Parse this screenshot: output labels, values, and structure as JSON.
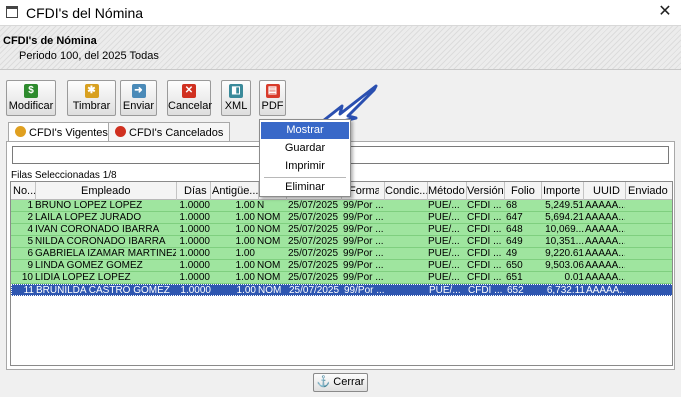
{
  "window": {
    "title": "CFDI's del Nómina",
    "close_glyph": "✕"
  },
  "header": {
    "title": "CFDI's de Nómina",
    "subtitle": "Periodo 100, del 2025 Todas"
  },
  "toolbar": [
    {
      "label": "Modificar",
      "icon": "dollar-icon",
      "color": "#2e8b2e",
      "glyph": "$"
    },
    {
      "label": "Timbrar",
      "icon": "stamp-icon",
      "color": "#d8a020",
      "glyph": "✱"
    },
    {
      "label": "Enviar",
      "icon": "send-icon",
      "color": "#4a8ab8",
      "glyph": "➜"
    },
    {
      "label": "Cancelar",
      "icon": "cancel-icon",
      "color": "#d03020",
      "glyph": "✕"
    },
    {
      "label": "XML",
      "icon": "xml-icon",
      "color": "#3a8a9a",
      "glyph": "◧"
    },
    {
      "label": "PDF",
      "icon": "pdf-icon",
      "color": "#d83a2a",
      "glyph": "▤"
    }
  ],
  "tabs": [
    {
      "label": "CFDI's Vigentes",
      "icon": "star-icon",
      "color": "#e0a020"
    },
    {
      "label": "CFDI's Cancelados",
      "icon": "cancel-circle-icon",
      "color": "#d03020"
    }
  ],
  "grid": {
    "row_count_label": "Filas Seleccionadas  1/8",
    "columns": [
      "No...",
      "Empleado",
      "Días",
      "Antigüe...",
      "",
      "",
      "Forma",
      "Condic...",
      "Método",
      "Versión",
      "Folio",
      "Importe",
      "UUID",
      "Enviado"
    ],
    "rows": [
      [
        "1",
        "BRUNO LOPEZ LOPEZ",
        "1.0000",
        "1.00",
        "N",
        "25/07/2025",
        "99/Por ...",
        "",
        "PUE/...",
        "CFDI ...",
        "68",
        "5,249.51",
        "AAAAA...",
        ""
      ],
      [
        "2",
        "LAILA LOPEZ JURADO",
        "1.0000",
        "1.00",
        "NOM",
        "25/07/2025",
        "99/Por ...",
        "",
        "PUE/...",
        "CFDI ...",
        "647",
        "5,694.21",
        "AAAAA...",
        ""
      ],
      [
        "4",
        "IVAN CORONADO IBARRA",
        "1.0000",
        "1.00",
        "NOM",
        "25/07/2025",
        "99/Por ...",
        "",
        "PUE/...",
        "CFDI ...",
        "648",
        "10,069...",
        "AAAAA...",
        ""
      ],
      [
        "5",
        "NILDA CORONADO IBARRA",
        "1.0000",
        "1.00",
        "NOM",
        "25/07/2025",
        "99/Por ...",
        "",
        "PUE/...",
        "CFDI ...",
        "649",
        "10,351...",
        "AAAAA...",
        ""
      ],
      [
        "6",
        "GABRIELA IZAMAR MARTINEZ",
        "1.0000",
        "1.00",
        "",
        "25/07/2025",
        "99/Por ...",
        "",
        "PUE/...",
        "CFDI ...",
        "49",
        "9,220.61",
        "AAAAA...",
        ""
      ],
      [
        "9",
        "LINDA GOMEZ GOMEZ",
        "1.0000",
        "1.00",
        "NOM",
        "25/07/2025",
        "99/Por ...",
        "",
        "PUE/...",
        "CFDI ...",
        "650",
        "9,503.06",
        "AAAAA...",
        ""
      ],
      [
        "10",
        "LIDIA LOPEZ LOPEZ",
        "1.0000",
        "1.00",
        "NOM",
        "25/07/2025",
        "99/Por ...",
        "",
        "PUE/...",
        "CFDI ...",
        "651",
        "0.01",
        "AAAAA...",
        ""
      ],
      [
        "11",
        "BRUNILDA CASTRO GOMEZ",
        "1.0000",
        "1.00",
        "NOM",
        "25/07/2025",
        "99/Por ...",
        "",
        "PUE/...",
        "CFDI ...",
        "652",
        "6,732.11",
        "AAAAA...",
        ""
      ]
    ],
    "selected_row": 7
  },
  "context_menu": {
    "items": [
      "Mostrar",
      "Guardar",
      "Imprimir",
      "Eliminar"
    ],
    "highlighted": 0
  },
  "footer": {
    "close_label": "Cerrar",
    "close_icon": "anchor-icon"
  },
  "colors": {
    "row_green": "#9fe59f",
    "row_selected": "#2e56b0",
    "menu_highlight": "#3868c8"
  }
}
